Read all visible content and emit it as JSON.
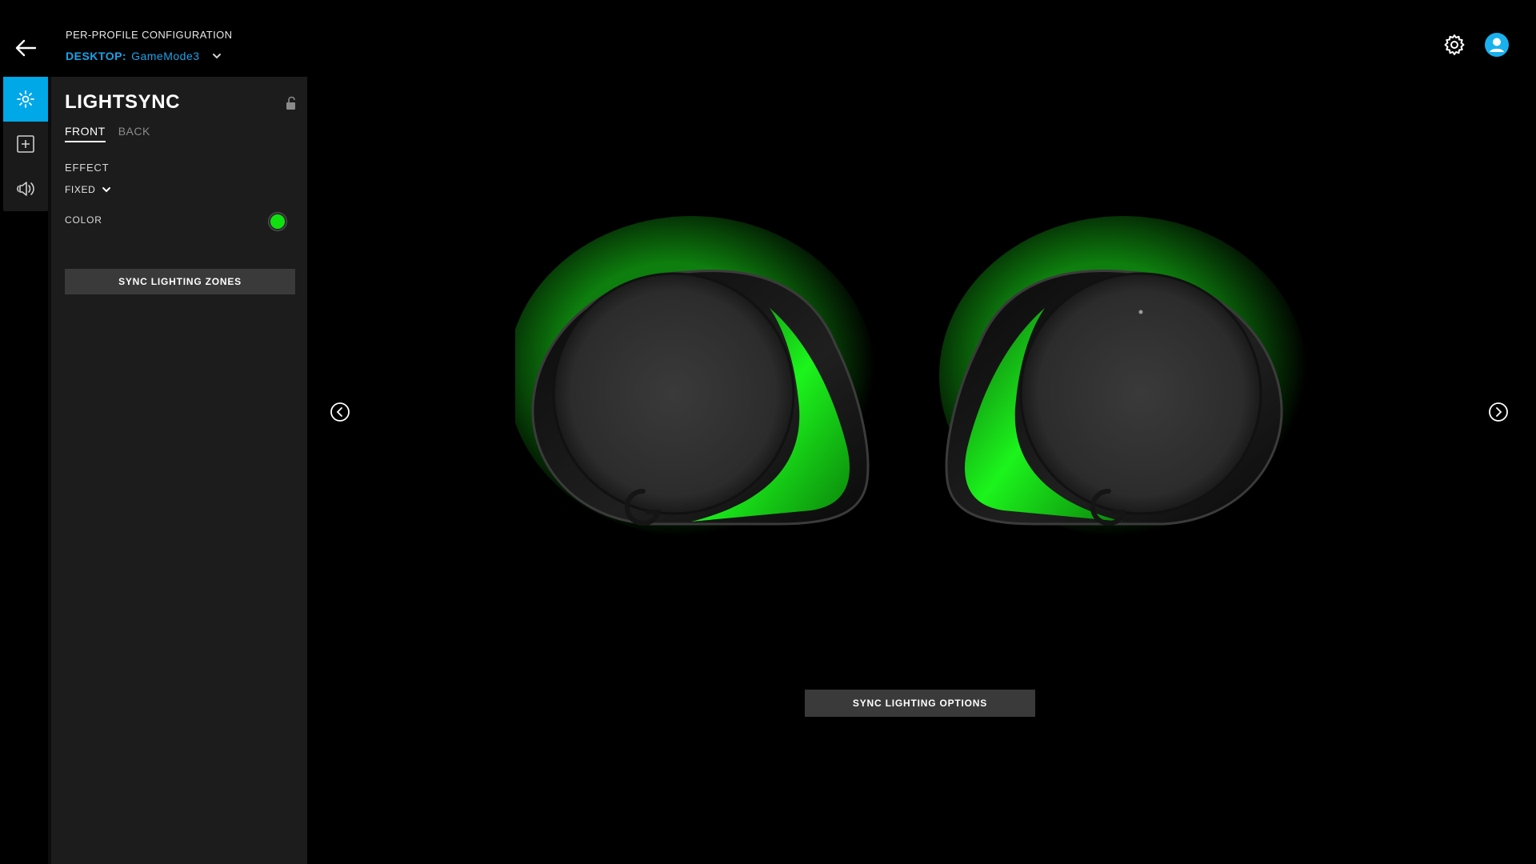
{
  "header": {
    "title": "PER-PROFILE CONFIGURATION",
    "profile_prefix": "DESKTOP:",
    "profile_name": "GameMode3"
  },
  "icons": {
    "back": "arrow-left-icon",
    "settings": "gear-icon",
    "account": "user-avatar-icon",
    "rail": [
      "lighting-icon",
      "add-assignment-icon",
      "speaker-volume-icon"
    ],
    "lock": "unlock-icon"
  },
  "panel": {
    "title": "LIGHTSYNC",
    "tabs": [
      {
        "label": "FRONT",
        "active": true
      },
      {
        "label": "BACK",
        "active": false
      }
    ],
    "effect_label": "EFFECT",
    "effect_value": "FIXED",
    "color_label": "COLOR",
    "color_value": "#10e010",
    "sync_zones_label": "SYNC LIGHTING ZONES"
  },
  "stage": {
    "sync_options_label": "SYNC LIGHTING OPTIONS"
  },
  "colors": {
    "accent": "#00a8e8",
    "profile_text": "#1aa3e8",
    "glow": "#19e619"
  }
}
